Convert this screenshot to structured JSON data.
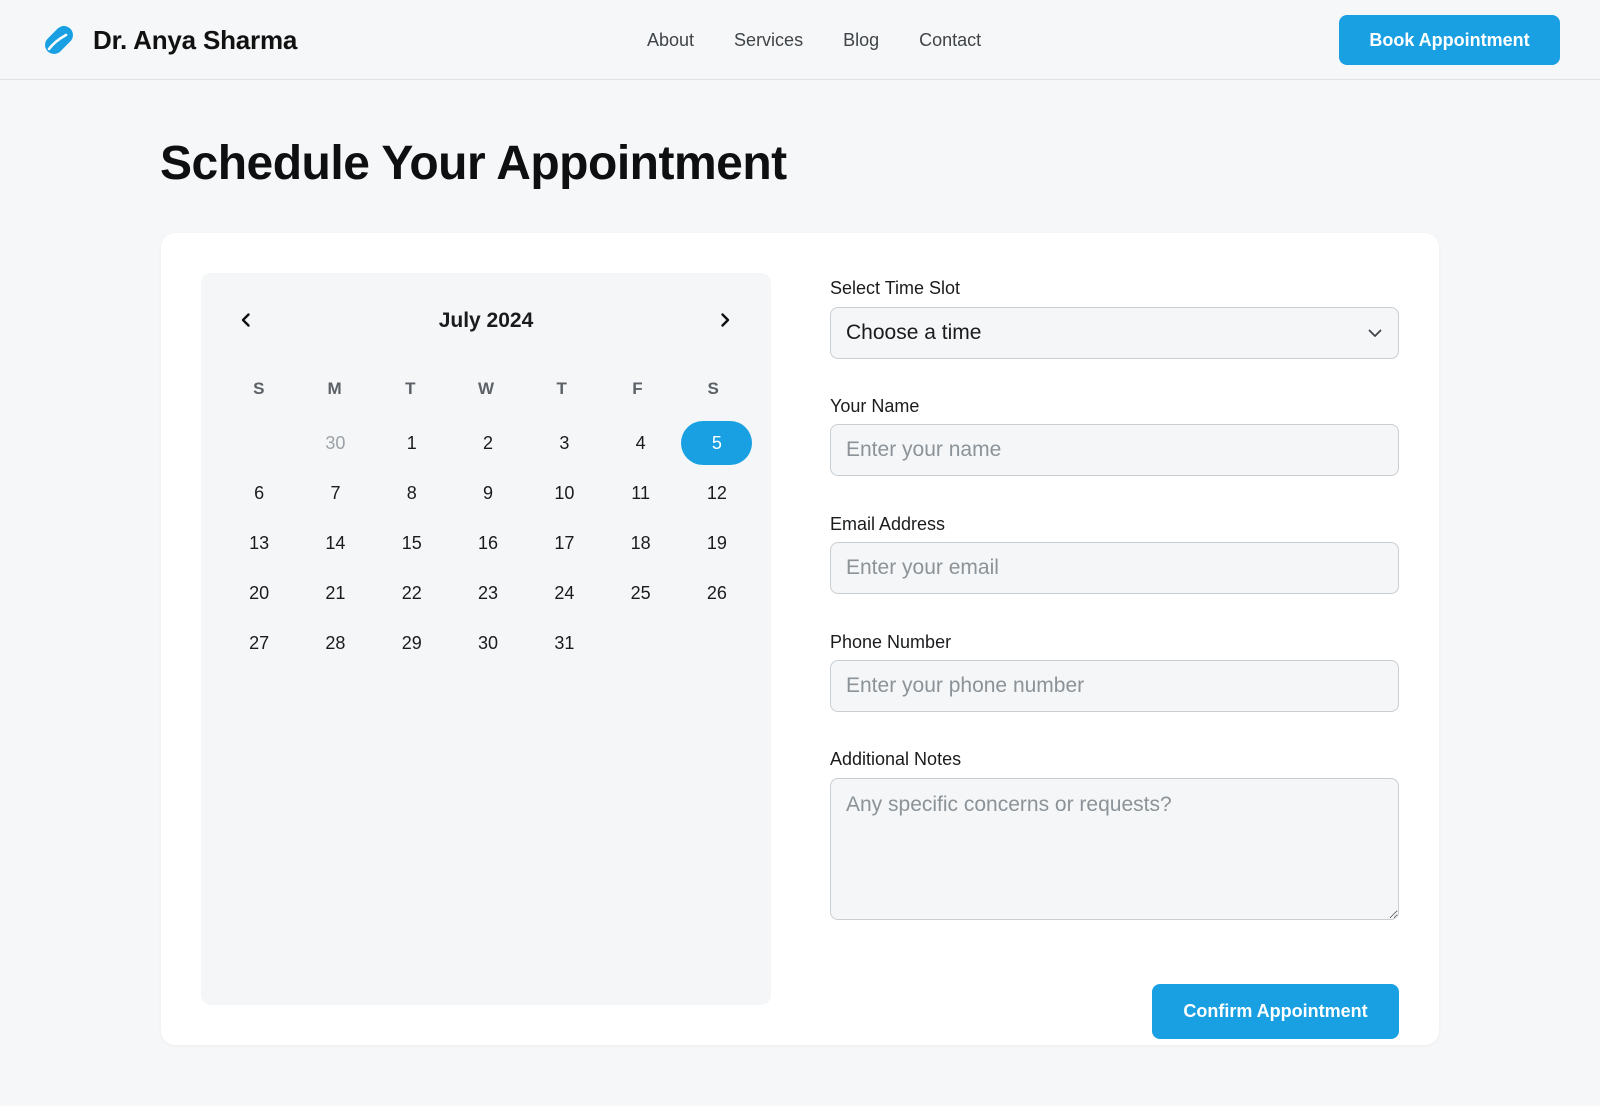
{
  "header": {
    "brand_name": "Dr. Anya Sharma",
    "nav": [
      "About",
      "Services",
      "Blog",
      "Contact"
    ],
    "cta_label": "Book Appointment"
  },
  "page": {
    "title": "Schedule Your Appointment"
  },
  "calendar": {
    "month_label": "July 2024",
    "weekdays": [
      "S",
      "M",
      "T",
      "W",
      "T",
      "F",
      "S"
    ],
    "days": [
      {
        "label": "",
        "muted": false
      },
      {
        "label": "30",
        "muted": true
      },
      {
        "label": "1"
      },
      {
        "label": "2"
      },
      {
        "label": "3"
      },
      {
        "label": "4"
      },
      {
        "label": "5",
        "selected": true
      },
      {
        "label": "6"
      },
      {
        "label": "7"
      },
      {
        "label": "8"
      },
      {
        "label": "9"
      },
      {
        "label": "10"
      },
      {
        "label": "11"
      },
      {
        "label": "12"
      },
      {
        "label": "13"
      },
      {
        "label": "14"
      },
      {
        "label": "15"
      },
      {
        "label": "16"
      },
      {
        "label": "17"
      },
      {
        "label": "18"
      },
      {
        "label": "19"
      },
      {
        "label": "20"
      },
      {
        "label": "21"
      },
      {
        "label": "22"
      },
      {
        "label": "23"
      },
      {
        "label": "24"
      },
      {
        "label": "25"
      },
      {
        "label": "26"
      },
      {
        "label": "27"
      },
      {
        "label": "28"
      },
      {
        "label": "29"
      },
      {
        "label": "30"
      },
      {
        "label": "31"
      }
    ],
    "selected_day": "5"
  },
  "form": {
    "time_slot": {
      "label": "Select Time Slot",
      "value": "Choose a time"
    },
    "name": {
      "label": "Your Name",
      "placeholder": "Enter your name",
      "value": ""
    },
    "email": {
      "label": "Email Address",
      "placeholder": "Enter your email",
      "value": ""
    },
    "phone": {
      "label": "Phone Number",
      "placeholder": "Enter your phone number",
      "value": ""
    },
    "notes": {
      "label": "Additional Notes",
      "placeholder": "Any specific concerns or requests?",
      "value": ""
    },
    "submit_label": "Confirm Appointment"
  },
  "colors": {
    "accent": "#18a0e3",
    "background": "#f5f7f8",
    "card": "#ffffff",
    "calendar_bg": "#f4f6f7"
  },
  "icons": {
    "brand": "pill-icon",
    "prev": "chevron-left-icon",
    "next": "chevron-right-icon",
    "select": "chevron-down-icon"
  }
}
